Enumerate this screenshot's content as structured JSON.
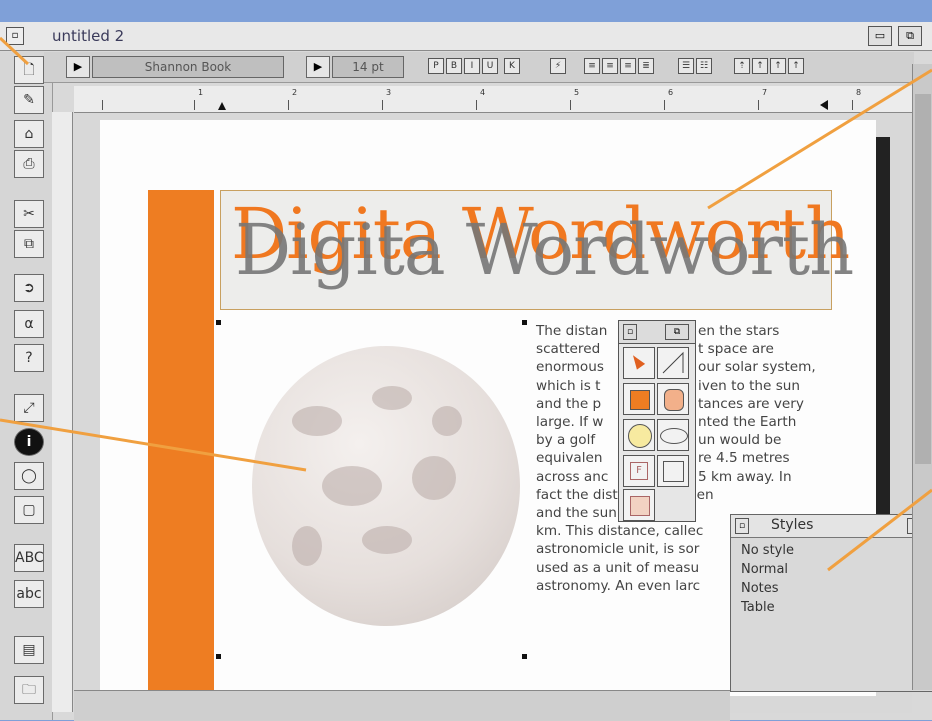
{
  "window": {
    "title": "untitled 2",
    "close_glyph": "◻"
  },
  "toolbar": {
    "font_name": "Shannon Book",
    "font_size": "14 pt"
  },
  "document": {
    "heading": "Digita Wordworth",
    "body_lines": [
      "The distan",
      "scattered",
      "enormous",
      "which is t",
      "and the p",
      "large. If w",
      "by a golf",
      "equivalen",
      "across anc",
      "fact the distance between",
      "and the sun is about 15",
      "km. This distance, callec",
      "astronomicle unit, is sor",
      "used as a unit of measu",
      "astronomy. An even larc"
    ],
    "body_lines_right": [
      "en the stars",
      "t space are",
      "our solar system,",
      "iven to the sun",
      "tances are very",
      "nted the Earth",
      "un would be",
      "re 4.5 metres",
      "5 km away. In",
      "",
      "",
      "",
      "",
      "",
      ""
    ]
  },
  "styles_panel": {
    "title": "Styles",
    "items": [
      "No style",
      "Normal",
      "Notes",
      "Table"
    ]
  },
  "ruler_numbers": [
    "1",
    "2",
    "3",
    "4",
    "5",
    "6",
    "7",
    "8"
  ],
  "colors": {
    "accent_orange": "#ee7d22",
    "callout_orange": "#f0a040"
  }
}
